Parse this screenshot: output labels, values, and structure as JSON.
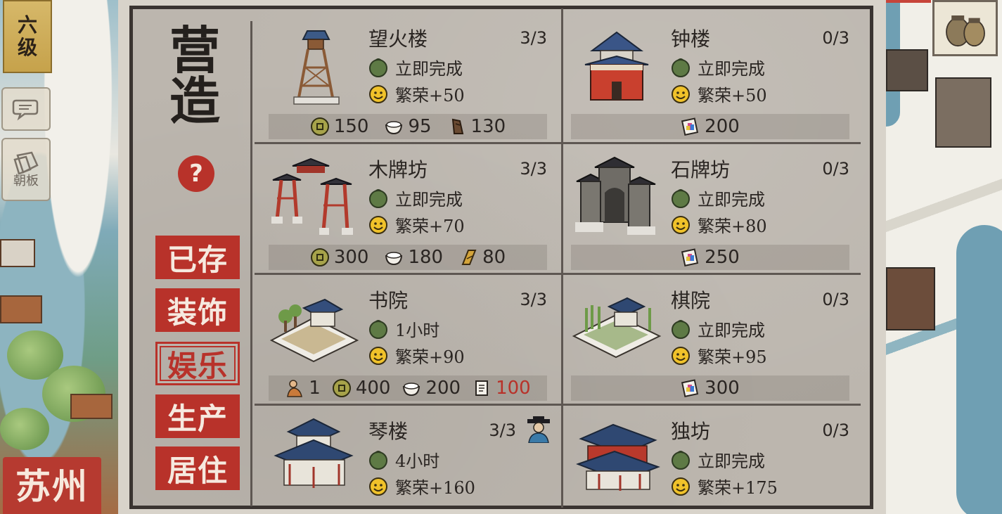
{
  "level": {
    "line1": "六",
    "line2": "级"
  },
  "side_buttons": [
    {
      "label": "",
      "icon": "chat-icon"
    },
    {
      "label": "朝板",
      "icon": "court-tablet-icon"
    }
  ],
  "city": "苏州",
  "panel": {
    "title": "营造",
    "help": "?",
    "categories": [
      {
        "label": "已存",
        "active": false
      },
      {
        "label": "装饰",
        "active": false
      },
      {
        "label": "娱乐",
        "active": true
      },
      {
        "label": "生产",
        "active": false
      },
      {
        "label": "居住",
        "active": false
      }
    ]
  },
  "buildings": [
    {
      "name": "望火楼",
      "count": "3/3",
      "time": "立即完成",
      "prosperity": "繁荣+50",
      "costs": [
        {
          "icon": "coin-icon",
          "value": "150"
        },
        {
          "icon": "rice-bowl-icon",
          "value": "95"
        },
        {
          "icon": "wood-icon",
          "value": "130"
        }
      ]
    },
    {
      "name": "钟楼",
      "count": "0/3",
      "time": "立即完成",
      "prosperity": "繁荣+50",
      "costs": [
        {
          "icon": "ticket-icon",
          "value": "200"
        }
      ]
    },
    {
      "name": "木牌坊",
      "count": "3/3",
      "time": "立即完成",
      "prosperity": "繁荣+70",
      "costs": [
        {
          "icon": "coin-icon",
          "value": "300"
        },
        {
          "icon": "rice-bowl-icon",
          "value": "180"
        },
        {
          "icon": "plank-icon",
          "value": "80"
        }
      ]
    },
    {
      "name": "石牌坊",
      "count": "0/3",
      "time": "立即完成",
      "prosperity": "繁荣+80",
      "costs": [
        {
          "icon": "ticket-icon",
          "value": "250"
        }
      ]
    },
    {
      "name": "书院",
      "count": "3/3",
      "time": "1小时",
      "prosperity": "繁荣+90",
      "costs": [
        {
          "icon": "worker-icon",
          "value": "1"
        },
        {
          "icon": "coin-icon",
          "value": "400"
        },
        {
          "icon": "rice-bowl-icon",
          "value": "200"
        },
        {
          "icon": "scroll-icon",
          "value": "100",
          "insufficient": true
        }
      ]
    },
    {
      "name": "棋院",
      "count": "0/3",
      "time": "立即完成",
      "prosperity": "繁荣+95",
      "costs": [
        {
          "icon": "ticket-icon",
          "value": "300"
        }
      ]
    },
    {
      "name": "琴楼",
      "count": "3/3",
      "time": "4小时",
      "prosperity": "繁荣+160",
      "official": true,
      "costs": []
    },
    {
      "name": "独坊",
      "count": "0/3",
      "time": "立即完成",
      "prosperity": "繁荣+175",
      "costs": []
    }
  ],
  "colors": {
    "accent_red": "#b8322a",
    "panel_bg": "#bcb6ae",
    "frame": "#3a3431",
    "insufficient": "#b8322a"
  }
}
